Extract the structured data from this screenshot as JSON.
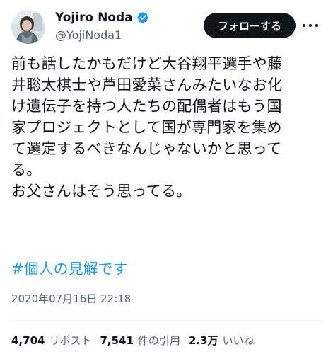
{
  "author": {
    "display_name": "Yojiro Noda",
    "handle": "@YojiNoda1",
    "verified": true
  },
  "follow_button": {
    "label": "フォローする"
  },
  "tweet": {
    "lines": [
      "前も話したかもだけど大谷翔平選手や藤",
      "井聡太棋士や芦田愛菜さんみたいなお化",
      "け遺伝子を持つ人たちの配偶者はもう国",
      "家プロジェクトとして国が専門家を集め",
      "て選定するべきなんじゃないかと思って",
      "る。",
      "お父さんはそう思ってる。"
    ],
    "hashtag": "#個人の見解です",
    "timestamp": "2020年07月16日 22:18"
  },
  "stats": [
    {
      "value": "4,704",
      "label": "リポスト"
    },
    {
      "value": "7,541",
      "label": "件の引用"
    },
    {
      "value": "2.3万",
      "label": "いいね"
    }
  ],
  "colors": {
    "text": "#0f1419",
    "secondary": "#536471",
    "link": "#1d9bf0",
    "verified": "#1d9bf0",
    "button_bg": "#0f1419",
    "button_text": "#ffffff"
  },
  "icons": {
    "verified": "verified-badge-icon",
    "more": "more-options-icon"
  }
}
